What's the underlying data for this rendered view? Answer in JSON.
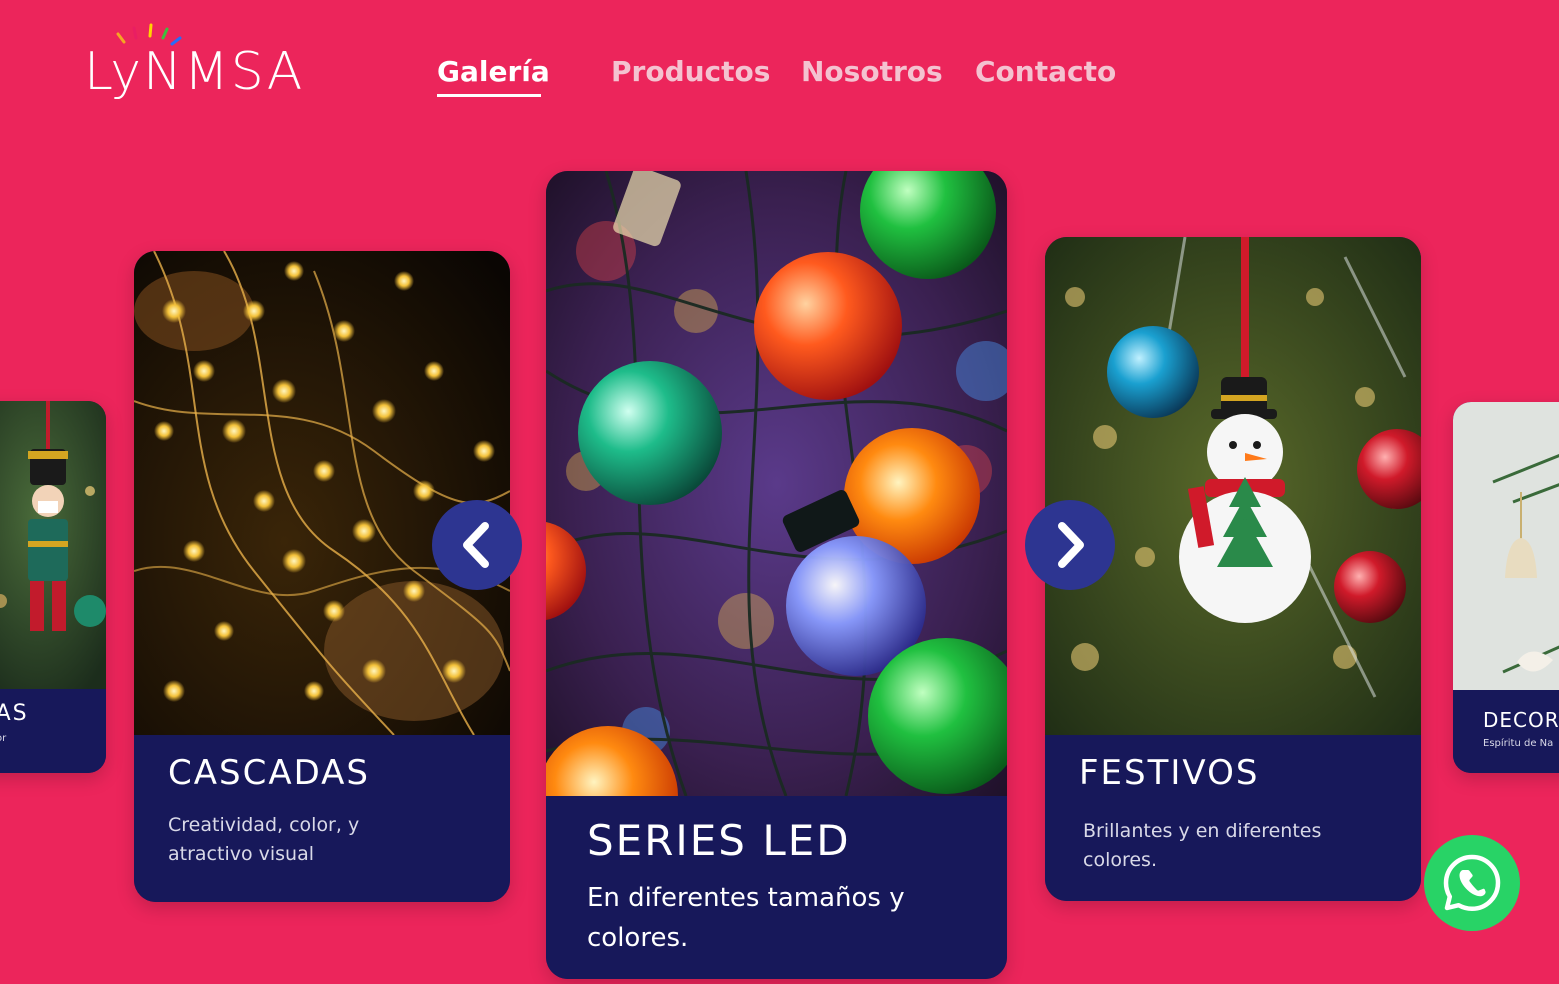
{
  "brand": {
    "logo_text": "LyNMSA",
    "background_color": "#ec255b",
    "card_color": "#17185a",
    "arrow_color": "#2d3591",
    "whatsapp_color": "#28d366"
  },
  "nav": {
    "items": [
      {
        "label": "Galería",
        "active": true
      },
      {
        "label": "Productos",
        "active": false
      },
      {
        "label": "Nosotros",
        "active": false
      },
      {
        "label": "Contacto",
        "active": false
      }
    ]
  },
  "carousel": {
    "cards": [
      {
        "title": "ADAS",
        "description": "or",
        "image": "nutcracker-ornament"
      },
      {
        "title": "CASCADAS",
        "description": "Creatividad, color, y atractivo visual",
        "image": "warm-string-lights"
      },
      {
        "title": "SERIES LED",
        "description": "En diferentes tamaños y colores.",
        "image": "colorful-led-bulbs"
      },
      {
        "title": "FESTIVOS",
        "description": "Brillantes y en diferentes colores.",
        "image": "snowman-ornament"
      },
      {
        "title": "DECOR",
        "description": "Espíritu de Na",
        "image": "bell-ornament"
      }
    ],
    "prev_icon": "chevron-left-icon",
    "next_icon": "chevron-right-icon"
  },
  "whatsapp": {
    "icon": "whatsapp-icon"
  }
}
